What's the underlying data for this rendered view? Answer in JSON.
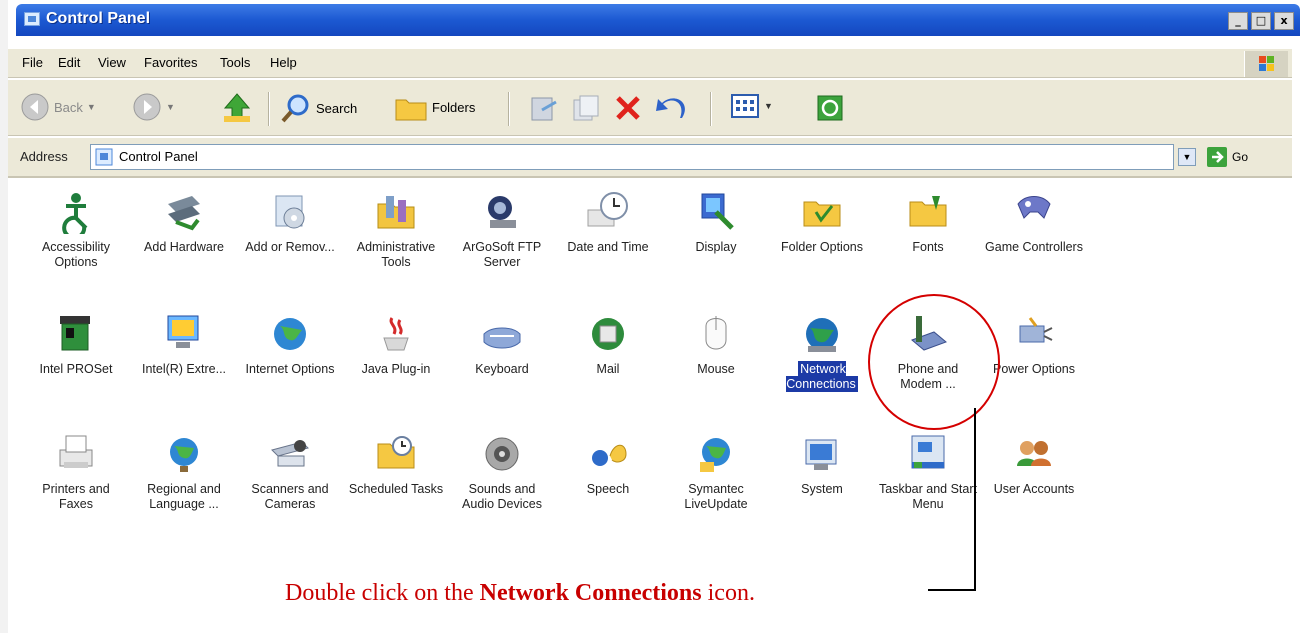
{
  "window": {
    "title": "Control Panel",
    "buttons": [
      "_",
      "□",
      "x"
    ]
  },
  "menu": [
    "File",
    "Edit",
    "View",
    "Favorites",
    "Tools",
    "Help"
  ],
  "toolbar": {
    "back": "Back",
    "search": "Search",
    "folders": "Folders"
  },
  "address": {
    "label": "Address",
    "value": "Control Panel",
    "go": "Go"
  },
  "items": [
    {
      "label": "Accessibility Options",
      "icon": "accessibility-icon"
    },
    {
      "label": "Add Hardware",
      "icon": "hardware-icon"
    },
    {
      "label": "Add or Remov...",
      "icon": "add-remove-icon"
    },
    {
      "label": "Administrative Tools",
      "icon": "admin-tools-icon"
    },
    {
      "label": "ArGoSoft FTP Server",
      "icon": "ftp-server-icon"
    },
    {
      "label": "Date and Time",
      "icon": "clock-icon"
    },
    {
      "label": "Display",
      "icon": "display-icon"
    },
    {
      "label": "Folder Options",
      "icon": "folder-options-icon"
    },
    {
      "label": "Fonts",
      "icon": "fonts-folder-icon"
    },
    {
      "label": "Game Controllers",
      "icon": "gamepad-icon"
    },
    {
      "label": "Intel PROSet",
      "icon": "network-card-icon"
    },
    {
      "label": "Intel(R) Extre...",
      "icon": "graphics-monitor-icon"
    },
    {
      "label": "Internet Options",
      "icon": "globe-icon"
    },
    {
      "label": "Java Plug-in",
      "icon": "java-icon"
    },
    {
      "label": "Keyboard",
      "icon": "keyboard-icon"
    },
    {
      "label": "Mail",
      "icon": "mail-icon"
    },
    {
      "label": "Mouse",
      "icon": "mouse-icon"
    },
    {
      "label": "Network Connections",
      "icon": "network-globe-icon"
    },
    {
      "label": "Phone and Modem ...",
      "icon": "phone-icon"
    },
    {
      "label": "Power Options",
      "icon": "power-icon"
    },
    {
      "label": "Printers and Faxes",
      "icon": "printer-icon"
    },
    {
      "label": "Regional and Language ...",
      "icon": "regional-globe-icon"
    },
    {
      "label": "Scanners and Cameras",
      "icon": "scanner-icon"
    },
    {
      "label": "Scheduled Tasks",
      "icon": "scheduled-tasks-icon"
    },
    {
      "label": "Sounds and Audio Devices",
      "icon": "speaker-icon"
    },
    {
      "label": "Speech",
      "icon": "speech-icon"
    },
    {
      "label": "Symantec LiveUpdate",
      "icon": "liveupdate-icon"
    },
    {
      "label": "System",
      "icon": "system-icon"
    },
    {
      "label": "Taskbar and Start Menu",
      "icon": "taskbar-icon"
    },
    {
      "label": "User Accounts",
      "icon": "users-icon"
    }
  ],
  "annotation": {
    "pre": "Double click on the ",
    "bold": "Network Connections",
    "post": " icon."
  },
  "colors": {
    "annotation": "#c80000",
    "selection": "#1c3aa6"
  }
}
